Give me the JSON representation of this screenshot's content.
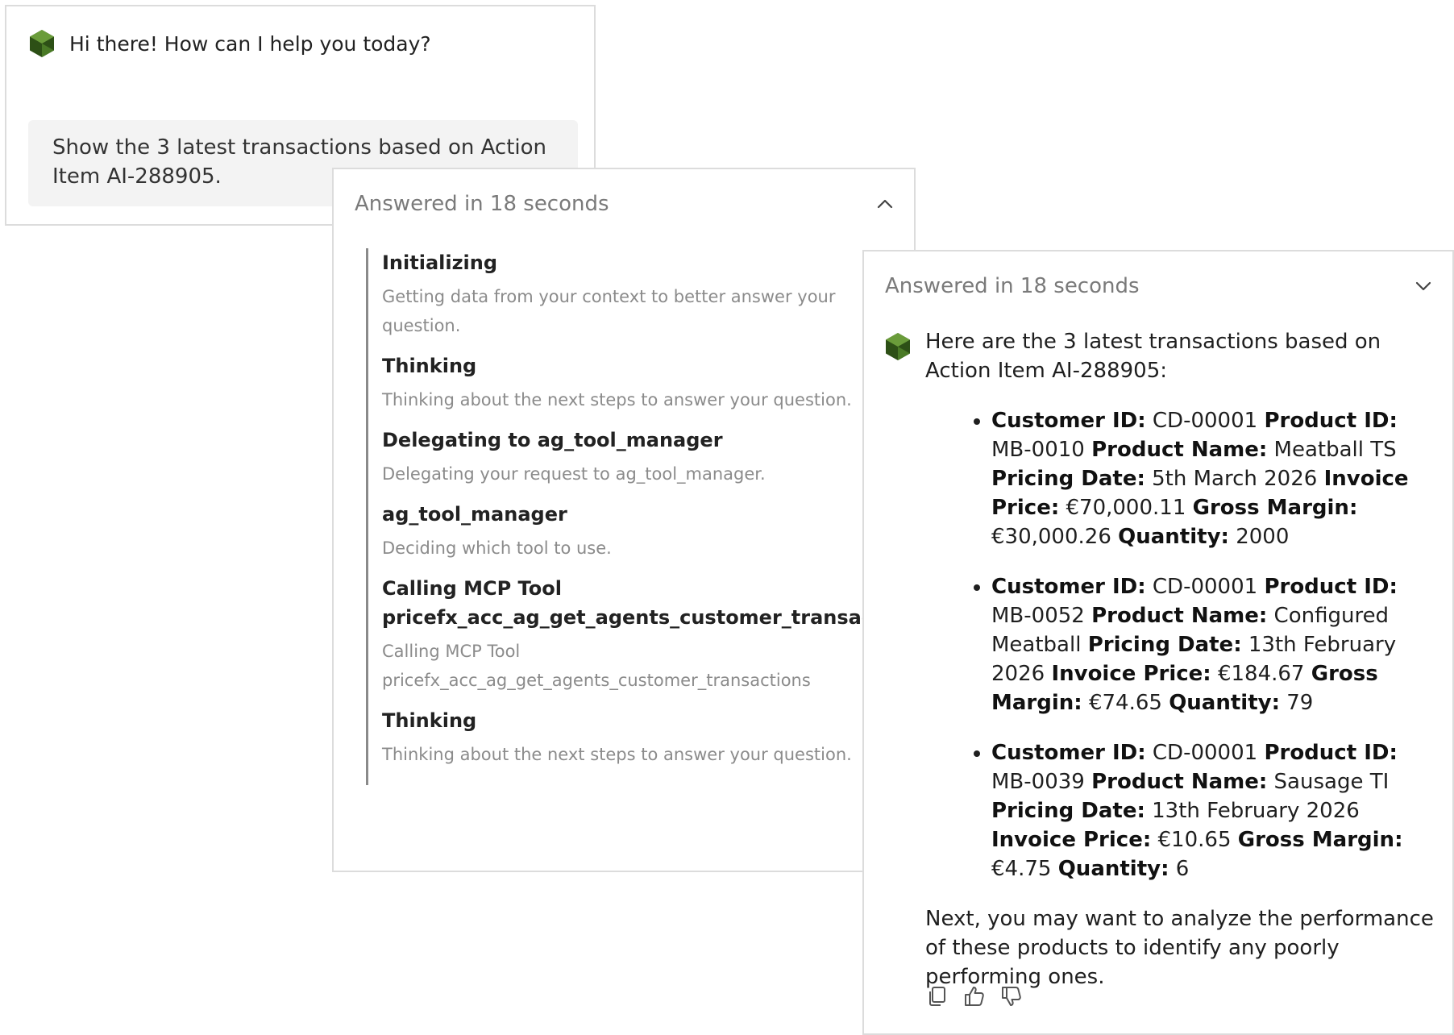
{
  "greeting": {
    "text": "Hi there! How can I help you today?",
    "user_message": "Show the 3 latest transactions based on Action Item AI-288905."
  },
  "process_panel": {
    "header": "Answered in 18 seconds",
    "header_icon": "chevron-up-icon",
    "steps": [
      {
        "title": "Initializing",
        "desc": "Getting data from your context to better answer your question."
      },
      {
        "title": "Thinking",
        "desc": "Thinking about the next steps to answer your question."
      },
      {
        "title": "Delegating to ag_tool_manager",
        "desc": "Delegating your request to ag_tool_manager."
      },
      {
        "title": "ag_tool_manager",
        "desc": "Deciding which tool to use."
      },
      {
        "title": "Calling MCP Tool pricefx_acc_ag_get_agents_customer_transactions",
        "desc": "Calling MCP Tool pricefx_acc_ag_get_agents_customer_transactions"
      },
      {
        "title": "Thinking",
        "desc": "Thinking about the next steps to answer your question."
      }
    ]
  },
  "answer_panel": {
    "header": "Answered in 18 seconds",
    "header_icon": "chevron-down-icon",
    "intro": "Here are the 3 latest transactions based on Action Item AI-288905:",
    "labels": {
      "customer_id": "Customer ID:",
      "product_id": "Product ID:",
      "product_name": "Product Name:",
      "pricing_date": "Pricing Date:",
      "invoice_price": "Invoice Price:",
      "gross_margin": "Gross Margin:",
      "quantity": "Quantity:"
    },
    "transactions": [
      {
        "customer_id": "CD-00001",
        "product_id": "MB-0010",
        "product_name": "Meatball TS",
        "pricing_date": "5th March 2026",
        "invoice_price": "€70,000.11",
        "gross_margin": "€30,000.26",
        "quantity": "2000"
      },
      {
        "customer_id": "CD-00001",
        "product_id": "MB-0052",
        "product_name": "Configured Meatball",
        "pricing_date": "13th February 2026",
        "invoice_price": "€184.67",
        "gross_margin": "€74.65",
        "quantity": "79"
      },
      {
        "customer_id": "CD-00001",
        "product_id": "MB-0039",
        "product_name": "Sausage TI",
        "pricing_date": "13th February 2026",
        "invoice_price": "€10.65",
        "gross_margin": "€4.75",
        "quantity": "6"
      }
    ],
    "next": "Next, you may want to analyze the performance of these products to identify any poorly performing ones.",
    "actions": [
      "copy-icon",
      "thumbs-up-icon",
      "thumbs-down-icon"
    ]
  },
  "colors": {
    "logo_dark": "#2d5016",
    "logo_light": "#6a9c3a",
    "bubble_bg": "#f3f3f3",
    "border": "#dcdcdc",
    "muted_text": "#8b8b8b"
  }
}
